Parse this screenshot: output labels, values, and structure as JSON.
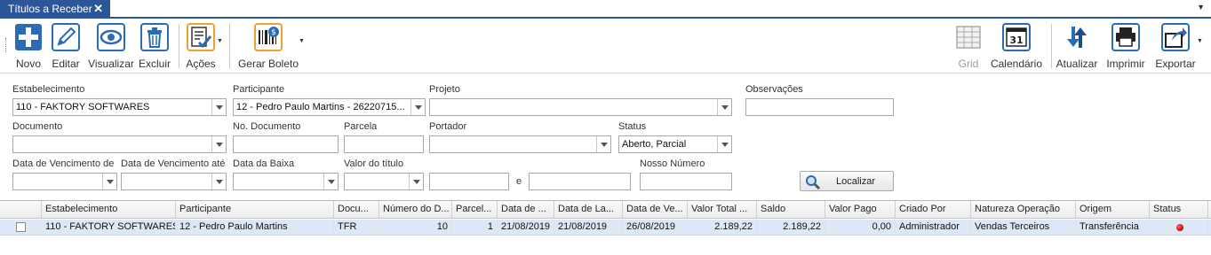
{
  "tab": {
    "title": "Títulos a Receber"
  },
  "toolbar": {
    "novo": "Novo",
    "editar": "Editar",
    "visualizar": "Visualizar",
    "excluir": "Excluir",
    "acoes": "Ações",
    "gerar_boleto": "Gerar Boleto",
    "grid": "Grid",
    "calendario": "Calendário",
    "calendario_day": "31",
    "atualizar": "Atualizar",
    "imprimir": "Imprimir",
    "exportar": "Exportar"
  },
  "filters": {
    "estabelecimento": {
      "label": "Estabelecimento",
      "value": "110 - FAKTORY SOFTWARES"
    },
    "participante": {
      "label": "Participante",
      "value": "12 - Pedro Paulo Martins - 26220715..."
    },
    "projeto": {
      "label": "Projeto",
      "value": ""
    },
    "observacoes": {
      "label": "Observações",
      "value": ""
    },
    "documento": {
      "label": "Documento",
      "value": ""
    },
    "no_documento": {
      "label": "No. Documento",
      "value": ""
    },
    "parcela": {
      "label": "Parcela",
      "value": ""
    },
    "portador": {
      "label": "Portador",
      "value": ""
    },
    "status": {
      "label": "Status",
      "value": "Aberto, Parcial"
    },
    "venc_de": {
      "label": "Data de Vencimento de",
      "value": ""
    },
    "venc_ate": {
      "label": "Data de Vencimento até",
      "value": ""
    },
    "data_baixa": {
      "label": "Data da Baixa",
      "value": ""
    },
    "valor_titulo": {
      "label": "Valor do título",
      "value": "",
      "value_from": "",
      "and_label": "e",
      "value_to": ""
    },
    "nosso_numero": {
      "label": "Nosso Número",
      "value": ""
    },
    "localizar": "Localizar"
  },
  "grid": {
    "columns": [
      "Estabelecimento",
      "Participante",
      "Docu...",
      "Número do D...",
      "Parcel...",
      "Data de ...",
      "Data de La...",
      "Data de Ve...",
      "Valor Total ...",
      "Saldo",
      "Valor Pago",
      "Criado Por",
      "Natureza Operação",
      "Origem",
      "Status"
    ],
    "rows": [
      {
        "estabelecimento": "110 - FAKTORY SOFTWARES",
        "participante": "12 - Pedro Paulo Martins",
        "documento": "TFR",
        "numero": "10",
        "parcela": "1",
        "data1": "21/08/2019",
        "data_lancamento": "21/08/2019",
        "data_vencimento": "26/08/2019",
        "valor_total": "2.189,22",
        "saldo": "2.189,22",
        "valor_pago": "0,00",
        "criado_por": "Administrador",
        "natureza": "Vendas Terceiros",
        "origem": "Transferência",
        "status_color": "#cc0000"
      }
    ]
  },
  "colors": {
    "accent": "#2b579a",
    "row_selected": "#dde8f6",
    "status_red": "#cc0000"
  }
}
